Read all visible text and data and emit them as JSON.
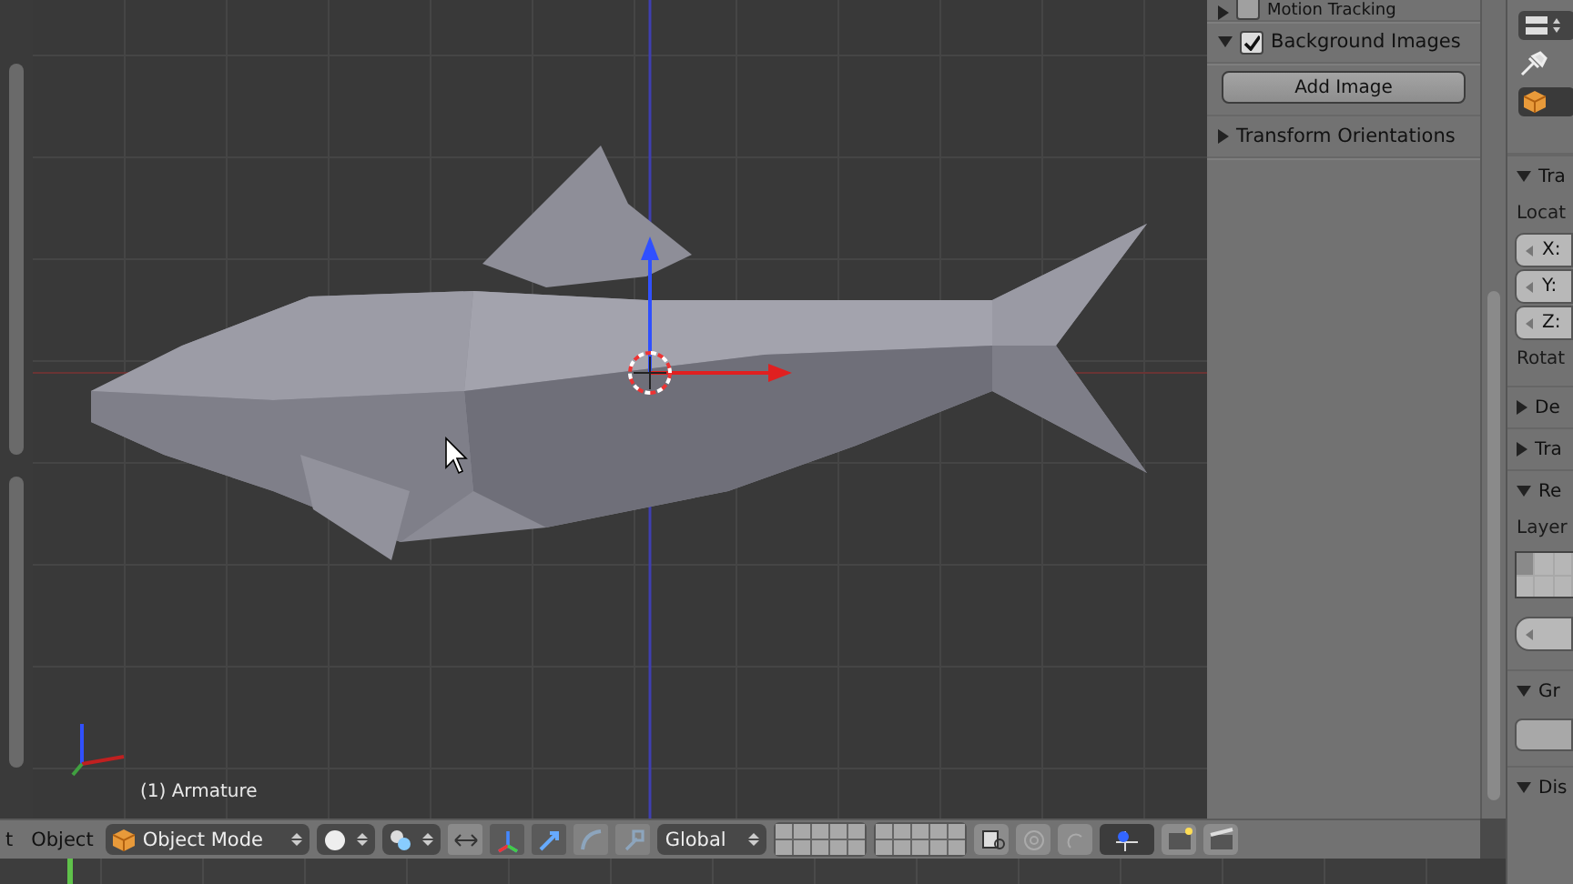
{
  "viewport": {
    "object_label": "(1) Armature"
  },
  "n_panel": {
    "panels": [
      {
        "title": "Motion Tracking",
        "kind": "check",
        "checked": false,
        "expanded": false
      },
      {
        "title": "Background Images",
        "kind": "check",
        "checked": true,
        "expanded": true,
        "button": "Add Image"
      },
      {
        "title": "Transform Orientations",
        "kind": "plain",
        "expanded": false
      }
    ]
  },
  "properties": {
    "panels": [
      {
        "title": "Tra",
        "expanded": true,
        "kind": "transform",
        "label": "Locat",
        "fields": [
          "X:",
          "Y:",
          "Z:"
        ],
        "label2": "Rotat"
      },
      {
        "title": "De",
        "expanded": false
      },
      {
        "title": "Tra",
        "expanded": false
      },
      {
        "title": "Re",
        "expanded": true,
        "kind": "layers",
        "label": "Layer"
      },
      {
        "title": "Gr",
        "expanded": true,
        "kind": "group"
      },
      {
        "title": "Dis",
        "expanded": true,
        "kind": "plain"
      }
    ]
  },
  "header": {
    "menus": [
      "t",
      "Object"
    ],
    "mode": "Object Mode",
    "orientation": "Global",
    "manipulators": [
      {
        "on": true
      },
      {
        "on": true
      },
      {
        "on": false
      },
      {
        "on": false
      }
    ]
  }
}
